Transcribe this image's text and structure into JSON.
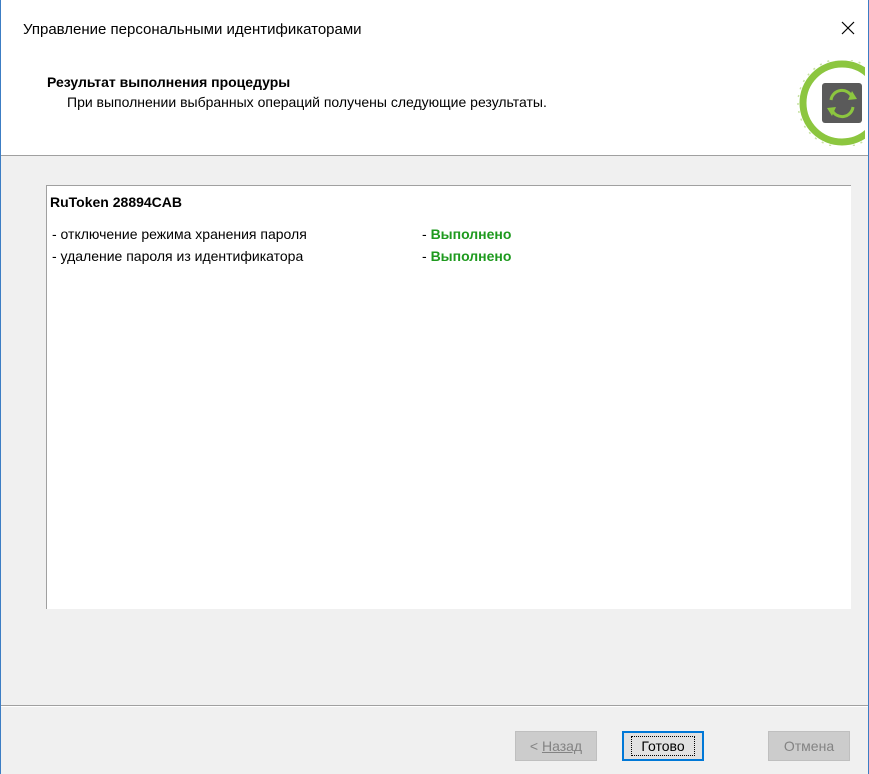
{
  "window": {
    "title": "Управление персональными идентификаторами"
  },
  "header": {
    "title": "Результат выполнения процедуры",
    "subtitle": "При выполнении выбранных операций получены следующие результаты.",
    "logo_icon": "refresh-cycle-icon",
    "logo_colors": {
      "ring": "#8cc63f",
      "tile": "#5a5a5a"
    }
  },
  "results": {
    "token_name": "RuToken 28894CAB",
    "operations": [
      {
        "label": "- отключение режима хранения пароля",
        "dash": "- ",
        "status": "Выполнено"
      },
      {
        "label": "- удаление пароля из идентификатора",
        "dash": "- ",
        "status": "Выполнено"
      }
    ],
    "status_color": "#1e9a1e"
  },
  "buttons": {
    "back_prefix": "< ",
    "back_label": "Назад",
    "finish_label": "Готово",
    "cancel_label": "Отмена"
  },
  "icons": {
    "close": "close-icon"
  }
}
